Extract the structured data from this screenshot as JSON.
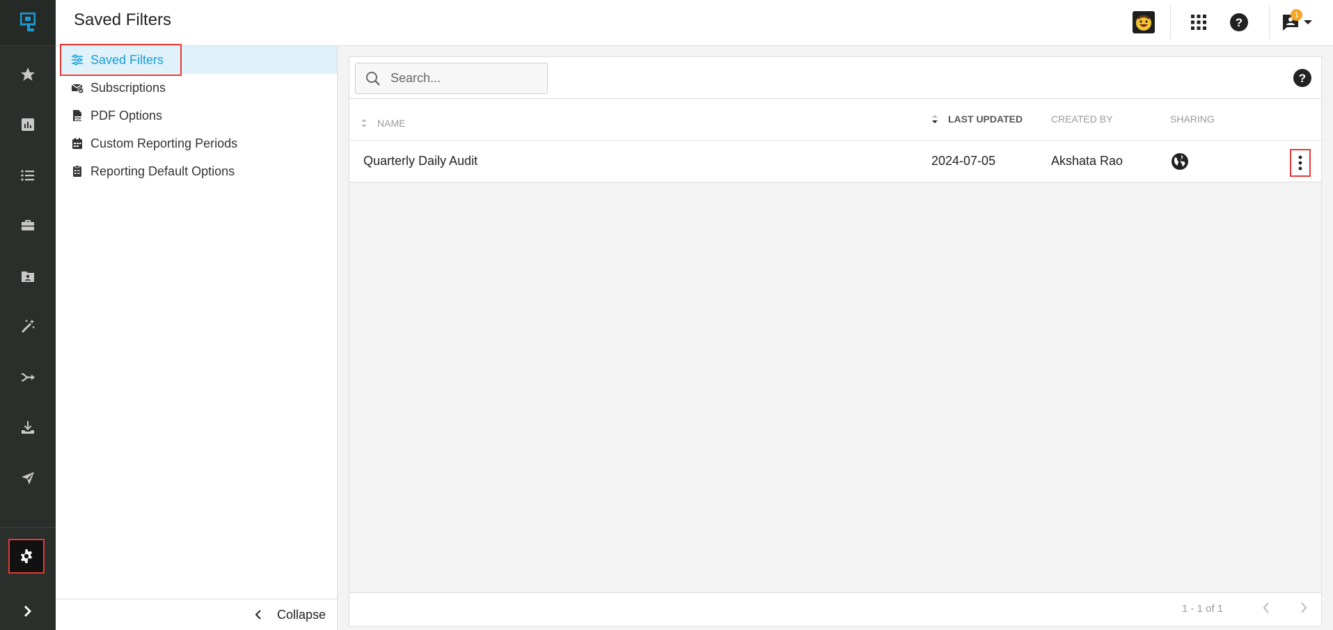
{
  "header": {
    "title": "Saved Filters",
    "notification_count": "1"
  },
  "rail": {
    "items": [
      "favorites",
      "dashboards",
      "reports-list",
      "portfolio",
      "folders",
      "magic",
      "workflows",
      "downloads",
      "distribution"
    ]
  },
  "sidenav": {
    "items": [
      {
        "label": "Saved Filters",
        "icon": "sliders-icon",
        "active": true
      },
      {
        "label": "Subscriptions",
        "icon": "envelope-check-icon",
        "active": false
      },
      {
        "label": "PDF Options",
        "icon": "pdf-file-icon",
        "active": false
      },
      {
        "label": "Custom Reporting Periods",
        "icon": "calendar-icon",
        "active": false
      },
      {
        "label": "Reporting Default Options",
        "icon": "clipboard-list-icon",
        "active": false
      }
    ],
    "collapse_label": "Collapse"
  },
  "search": {
    "placeholder": "Search..."
  },
  "table": {
    "columns": {
      "name": "NAME",
      "last_updated": "LAST UPDATED",
      "created_by": "CREATED BY",
      "sharing": "SHARING"
    },
    "rows": [
      {
        "name": "Quarterly Daily Audit",
        "last_updated": "2024-07-05",
        "created_by": "Akshata Rao",
        "sharing": "globe-icon"
      }
    ]
  },
  "pagination": {
    "range": "1 - 1 of 1"
  },
  "colors": {
    "rail": "#2b2f2b",
    "accent": "#1a9bd6",
    "active_bg": "#dff2fa",
    "highlight": "#e53935",
    "badge": "#f5a623"
  }
}
